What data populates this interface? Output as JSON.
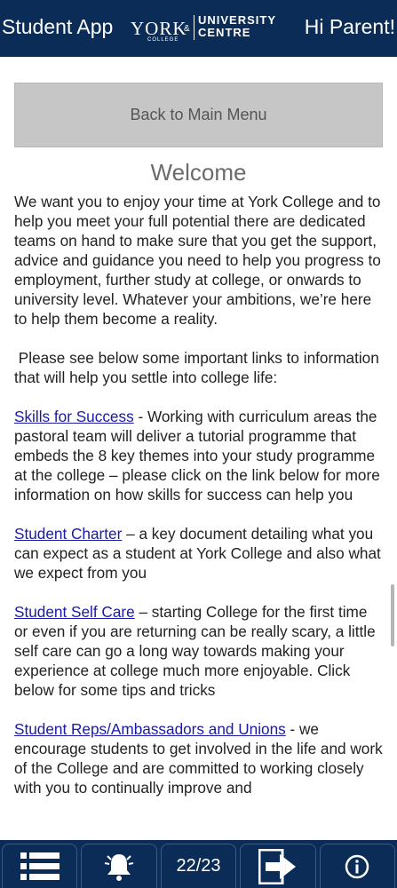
{
  "header": {
    "app_title": "Student App",
    "logo": {
      "york": "YORK",
      "college": "COLLEGE",
      "amp": "&",
      "university": "UNIVERSITY",
      "centre": "CENTRE"
    },
    "greeting": "Hi Parent!"
  },
  "main": {
    "back_button": "Back to Main Menu",
    "heading": "Welcome",
    "intro": "We want you to enjoy your time at York College and to help you meet your full potential there are dedicated teams on hand to make sure that you get the support, advice and guidance you need to help you progress to employment, further study at college, or onwards to university level. Whatever your ambitions, we’re here to help them become a reality.",
    "links_intro": " Please see below some important links to information that will help you settle into college life:",
    "sections": [
      {
        "link": "Skills for Success",
        "text": " - Working with curriculum areas the pastoral team will deliver a tutorial programme that embeds the 8 key themes into your study programme at the college – please click on the link below for more information on how skills for success can help you"
      },
      {
        "link": "Student Charter",
        "text": " – a key document detailing what you can expect as a student at York College and also what we expect from you"
      },
      {
        "link": "Student Self Care",
        "text": " – starting College for the first time or even if you are returning can be really scary, a little self care can go a long way towards making your experience at college much more enjoyable. Click below for some tips and tricks"
      },
      {
        "link": "Student Reps/Ambassadors and Unions",
        "text": " - we encourage students to get involved in the life and work of the College and are committed to working closely with you to continually improve and"
      }
    ]
  },
  "footer": {
    "page_indicator": "22/23",
    "icons": [
      "menu-icon",
      "bell-icon",
      "logout-icon",
      "info-icon"
    ]
  },
  "colors": {
    "header_bg": "#0a2c56",
    "link": "#1a1aa6",
    "button_bg": "#c6c6c6"
  }
}
